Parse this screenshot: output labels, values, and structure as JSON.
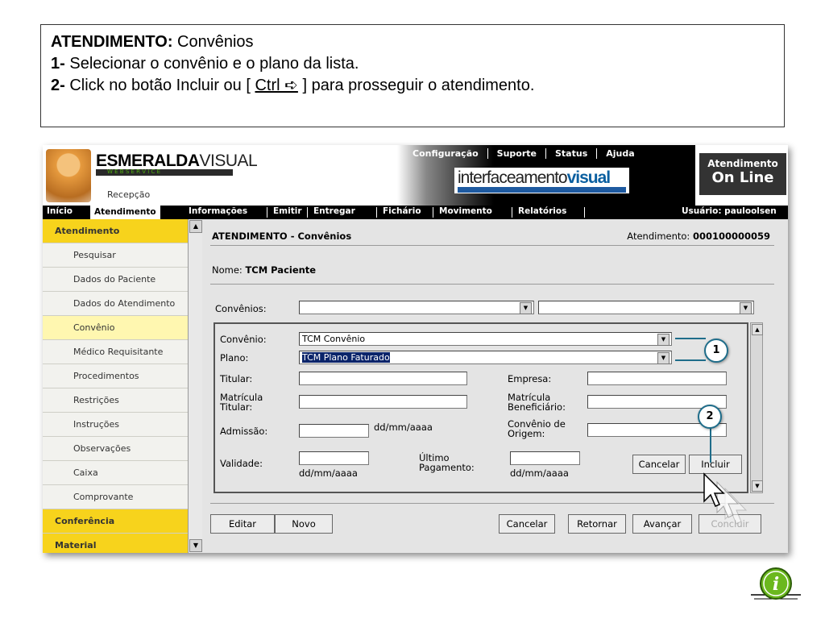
{
  "instructions": {
    "title_bold": "ATENDIMENTO:",
    "title_rest": " Convênios",
    "step1_num": "1-",
    "step1_text": " Selecionar o convênio e o plano da lista.",
    "step2_num": "2-",
    "step2_a": " Click no botão Incluir ou [ ",
    "step2_key": "Ctrl ➪",
    "step2_b": " ] para prosseguir o atendimento."
  },
  "header": {
    "logo_bold": "ESMERALDA",
    "logo_light": "VISUAL",
    "logo_sub": "W E B S E R V I C E",
    "reception": "Recepção",
    "toplinks": [
      "Configuração",
      "Suporte",
      "Status",
      "Ajuda"
    ],
    "brand_main": "interfaceamento",
    "brand_bold": "visual",
    "online_a": "Atendimento",
    "online_b": "On Line"
  },
  "nav": {
    "items": [
      "Início",
      "Atendimento",
      "Informações",
      "Emitir",
      "Entregar",
      "Fichário",
      "Movimento",
      "Relatórios"
    ],
    "user": "Usuário: pauloolsen"
  },
  "sidebar": {
    "section1": "Atendimento",
    "items": [
      "Pesquisar",
      "Dados do Paciente",
      "Dados do Atendimento",
      "Convênio",
      "Médico Requisitante",
      "Procedimentos",
      "Restrições",
      "Instruções",
      "Observações",
      "Caixa",
      "Comprovante"
    ],
    "section2": "Conferência",
    "section3": "Material"
  },
  "main": {
    "title": "ATENDIMENTO - Convênios",
    "atend_label": "Atendimento: ",
    "atend_num": "000100000059",
    "nome_label": "Nome: ",
    "nome_value": "TCM  Paciente",
    "convenios_label": "Convênios:",
    "form": {
      "convenio_label": "Convênio:",
      "convenio_value": "TCM Convênio",
      "plano_label": "Plano:",
      "plano_value": "TCM Plano Faturado",
      "titular_label": "Titular:",
      "empresa_label": "Empresa:",
      "matricula_titular_l1": "Matrícula",
      "matricula_titular_l2": "Titular:",
      "matricula_benef_l1": "Matrícula",
      "matricula_benef_l2": "Beneficiário:",
      "admissao_label": "Admissão:",
      "date_hint": "dd/mm/aaaa",
      "conv_origem_l1": "Convênio de",
      "conv_origem_l2": "Origem:",
      "validade_label": "Validade:",
      "ultimo_l1": "Último",
      "ultimo_l2": "Pagamento:",
      "cancelar": "Cancelar",
      "incluir": "Incluir"
    },
    "bottom_buttons": {
      "editar": "Editar",
      "novo": "Novo",
      "cancelar": "Cancelar",
      "retornar": "Retornar",
      "avancar": "Avançar",
      "concluir": "Concluir"
    }
  },
  "callouts": {
    "one": "1",
    "two": "2"
  },
  "icons": {
    "info": "info-icon",
    "cursor": "pointer-cursor-icon",
    "dropdown": "dropdown-arrow-icon"
  },
  "colors": {
    "sidebar_section": "#f7d31c",
    "selection": "#0a246a",
    "callout_border": "#1f6d8a",
    "info_green": "#6bb81e"
  }
}
